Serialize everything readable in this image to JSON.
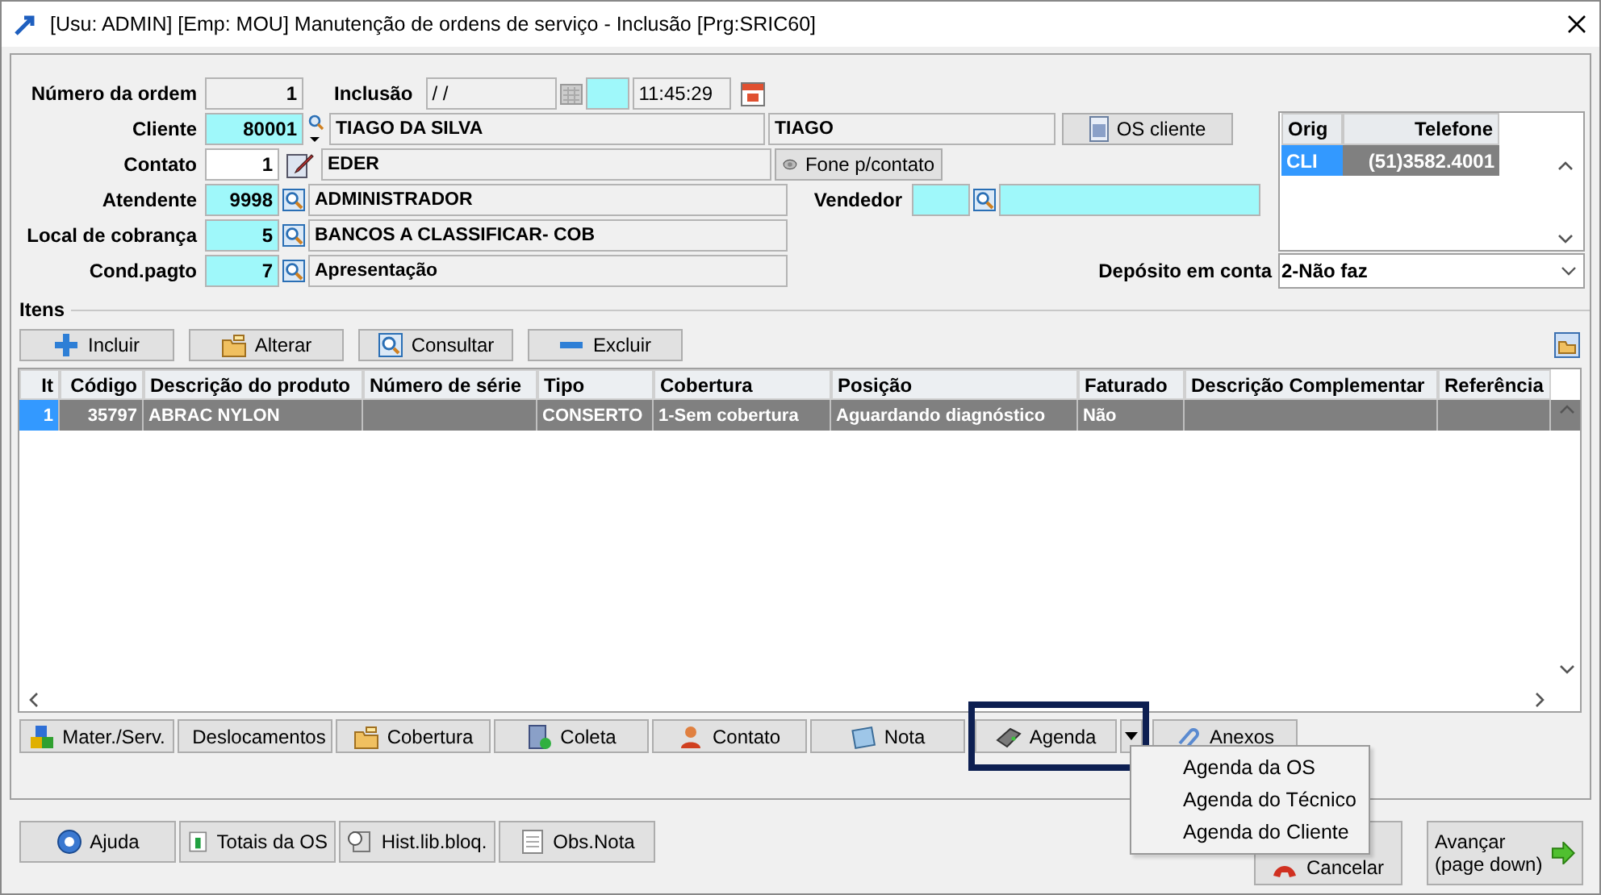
{
  "window": {
    "title": "[Usu: ADMIN] [Emp: MOU] Manutenção de ordens de serviço - Inclusão [Prg:SRIC60]"
  },
  "header": {
    "order": {
      "label": "Número da ordem",
      "value": "1"
    },
    "inclusao": {
      "label": "Inclusão",
      "date": "/ /",
      "time": "11:45:29"
    },
    "cliente": {
      "label": "Cliente",
      "code": "80001",
      "name": "TIAGO DA SILVA",
      "short_name": "TIAGO"
    },
    "os_cliente_button": "OS cliente",
    "contato": {
      "label": "Contato",
      "code": "1",
      "name": "EDER"
    },
    "fone_button": "Fone p/contato",
    "atendente": {
      "label": "Atendente",
      "code": "9998",
      "name": "ADMINISTRADOR"
    },
    "vendedor": {
      "label": "Vendedor"
    },
    "local_cobranca": {
      "label": "Local de cobrança",
      "code": "5",
      "name": "BANCOS A CLASSIFICAR- COB"
    },
    "cond_pagto": {
      "label": "Cond.pagto",
      "code": "7",
      "name": "Apresentação"
    },
    "phones": {
      "columns": [
        "Orig",
        "Telefone"
      ],
      "rows": [
        {
          "orig": "CLI",
          "telefone": "(51)3582.4001",
          "selected": true
        }
      ]
    },
    "deposito": {
      "label": "Depósito em conta",
      "value": "2-Não faz"
    }
  },
  "itens": {
    "title": "Itens",
    "buttons": [
      "Incluir",
      "Alterar",
      "Consultar",
      "Excluir"
    ],
    "table": {
      "columns": [
        "It",
        "Código",
        "Descrição do produto",
        "Número de série",
        "Tipo",
        "Cobertura",
        "Posição",
        "Faturado",
        "Descrição Complementar",
        "Referência"
      ],
      "rows": [
        {
          "cells": [
            "1",
            "35797",
            "ABRAC NYLON",
            "",
            "CONSERTO",
            "1-Sem cobertura",
            "Aguardando diagnóstico",
            "Não",
            "",
            ""
          ],
          "selected": true
        }
      ]
    },
    "tool_buttons": [
      {
        "label": "Mater./Serv.",
        "highlighted": false,
        "has_menu": false
      },
      {
        "label": "Deslocamentos",
        "highlighted": false,
        "has_menu": false
      },
      {
        "label": "Cobertura",
        "highlighted": false,
        "has_menu": false
      },
      {
        "label": "Coleta",
        "highlighted": false,
        "has_menu": false
      },
      {
        "label": "Contato",
        "highlighted": false,
        "has_menu": false
      },
      {
        "label": "Nota",
        "highlighted": false,
        "has_menu": false
      },
      {
        "label": "Agenda",
        "highlighted": true,
        "has_menu": true
      },
      {
        "label": "Anexos",
        "highlighted": false,
        "has_menu": false
      }
    ],
    "menu": [
      "Agenda da OS",
      "Agenda do Técnico",
      "Agenda do Cliente"
    ]
  },
  "footer": {
    "buttons": [
      "Ajuda",
      "Totais da OS",
      "Hist.lib.bloq.",
      "Obs.Nota"
    ],
    "cancel_button": "Cancelar",
    "next_button": {
      "line1": "Avançar",
      "line2": "(page down)"
    }
  }
}
